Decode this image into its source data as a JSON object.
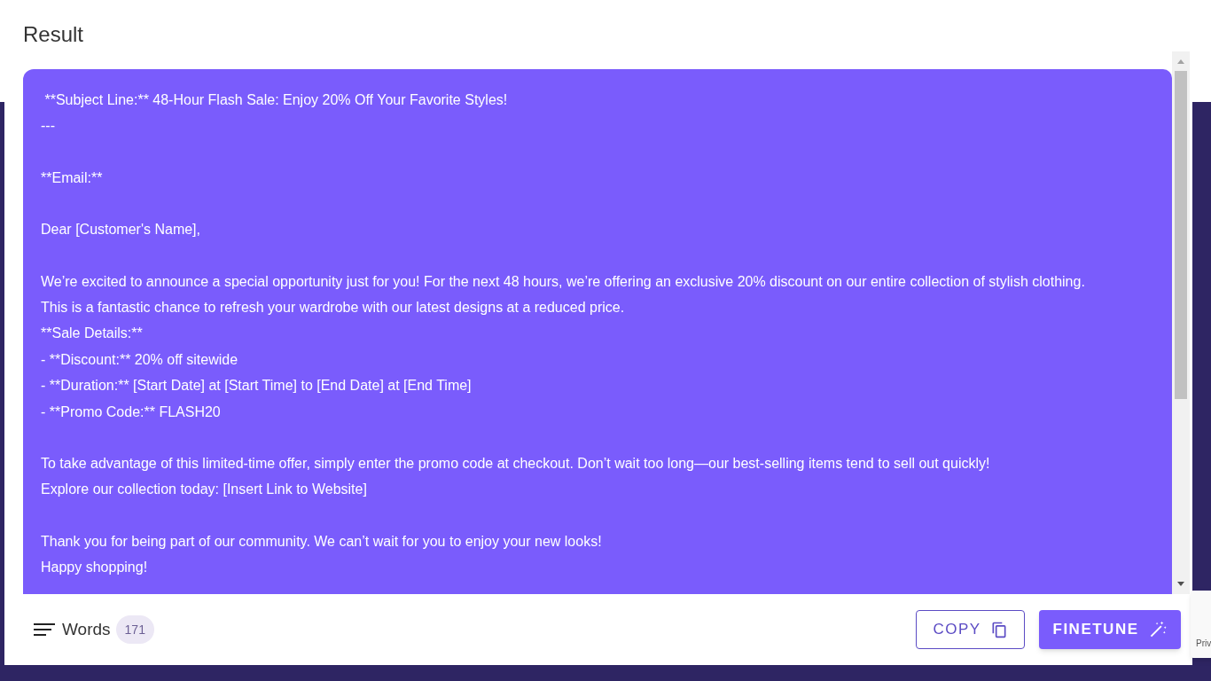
{
  "title": "Result",
  "blocks": [
    {
      "lines": [
        " **Subject Line:** 48-Hour Flash Sale: Enjoy 20% Off Your Favorite Styles!",
        "---"
      ]
    },
    {
      "lines": [
        "**Email:**"
      ]
    },
    {
      "lines": [
        "Dear [Customer's Name],"
      ]
    },
    {
      "lines": [
        "We’re excited to announce a special opportunity just for you! For the next 48 hours, we’re offering an exclusive 20% discount on our entire collection of stylish clothing. This is a fantastic chance to refresh your wardrobe with our latest designs at a reduced price.",
        "**Sale Details:**",
        "- **Discount:** 20% off sitewide",
        "- **Duration:** [Start Date] at [Start Time] to [End Date] at [End Time]",
        "- **Promo Code:** FLASH20"
      ]
    },
    {
      "lines": [
        "To take advantage of this limited-time offer, simply enter the promo code at checkout. Don’t wait too long—our best-selling items tend to sell out quickly!",
        "Explore our collection today: [Insert Link to Website]"
      ]
    },
    {
      "lines": [
        "Thank you for being part of our community. We can’t wait for you to enjoy your new looks!",
        "Happy shopping!"
      ]
    }
  ],
  "footer": {
    "label": "Words",
    "count": "171"
  },
  "buttons": [
    {
      "kind": "outline",
      "label": "COPY"
    },
    {
      "kind": "filled",
      "label": "FINETUNE"
    }
  ],
  "recaptcha": {
    "text": "Priv"
  }
}
